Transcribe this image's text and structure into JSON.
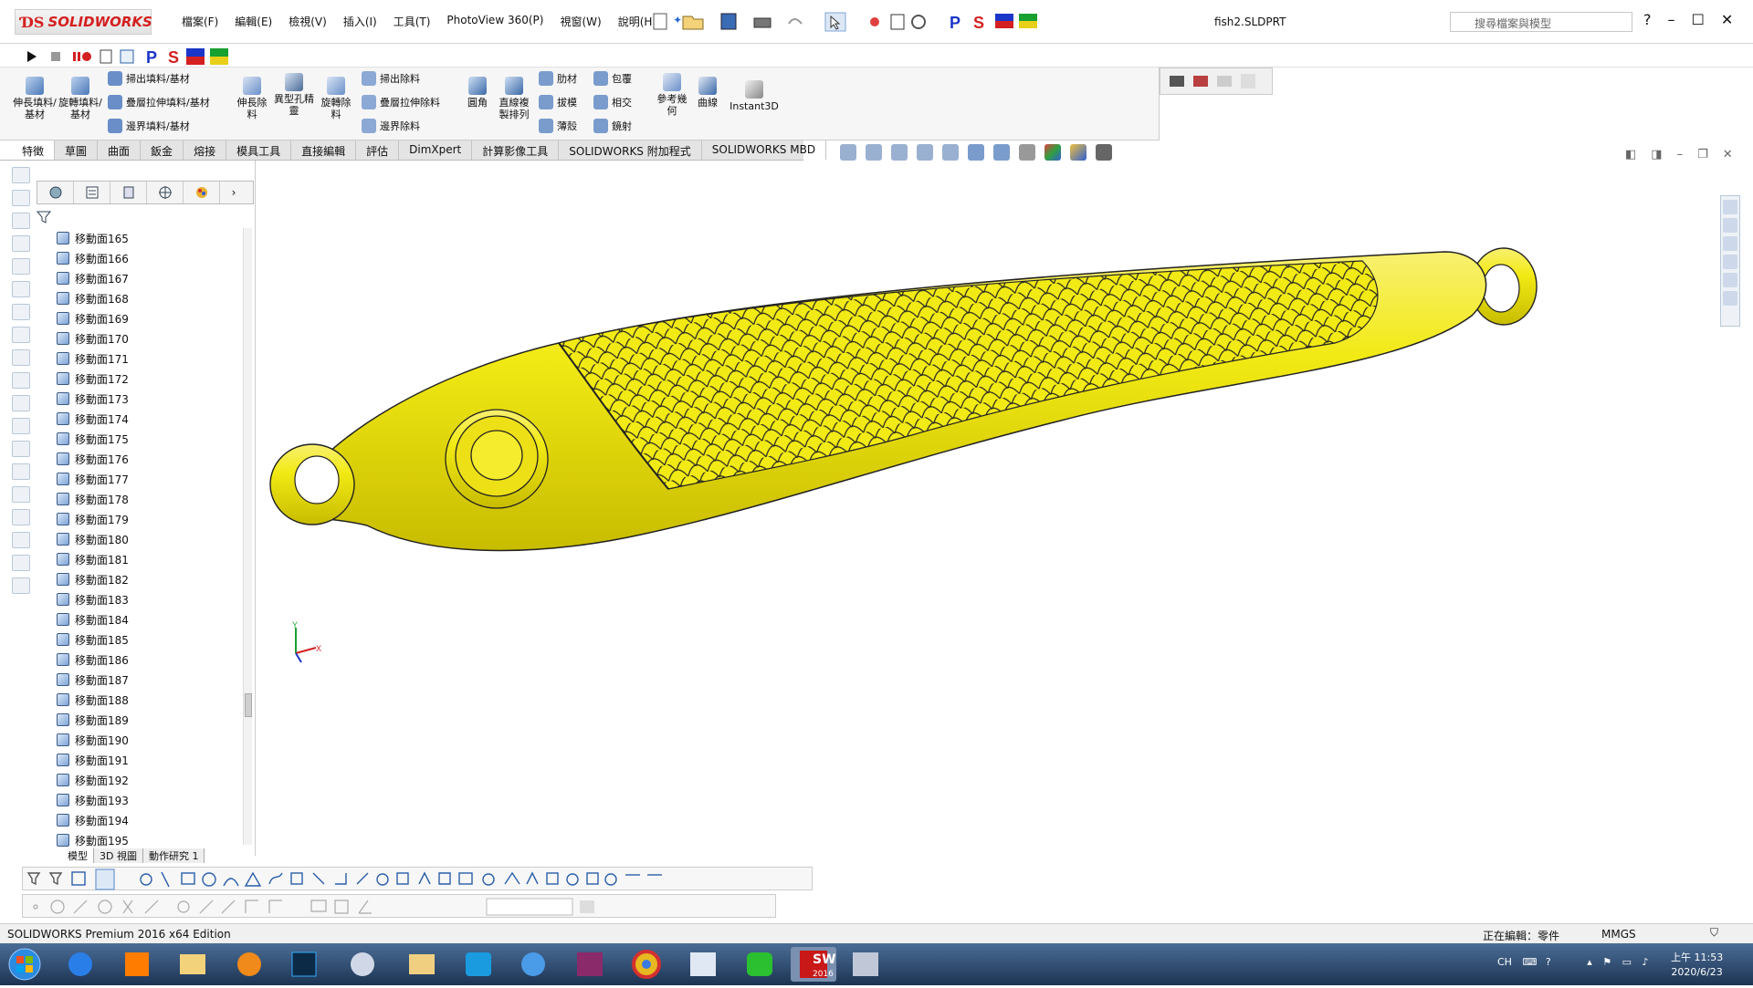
{
  "app": {
    "name": "SOLIDWORKS",
    "document_title": "fish2.SLDPRT"
  },
  "menu": [
    "檔案(F)",
    "編輯(E)",
    "檢視(V)",
    "插入(I)",
    "工具(T)",
    "PhotoView 360(P)",
    "視窗(W)",
    "說明(H)"
  ],
  "search": {
    "placeholder": "搜尋檔案與模型"
  },
  "commands": {
    "big": [
      {
        "label": "伸長填料/基材"
      },
      {
        "label": "旋轉填料/基材"
      },
      {
        "label": "伸長除料"
      },
      {
        "label": "異型孔精靈"
      },
      {
        "label": "旋轉除料"
      },
      {
        "label": "圓角"
      },
      {
        "label": "直線複製排列"
      },
      {
        "label": "參考幾何"
      },
      {
        "label": "曲線"
      },
      {
        "label": "Instant3D"
      }
    ],
    "rows": [
      {
        "label": "掃出填料/基材"
      },
      {
        "label": "疊層拉伸填料/基材"
      },
      {
        "label": "邊界填料/基材"
      },
      {
        "label": "掃出除料"
      },
      {
        "label": "疊層拉伸除料"
      },
      {
        "label": "邊界除料"
      },
      {
        "label": "肋材"
      },
      {
        "label": "拔模"
      },
      {
        "label": "薄殼"
      },
      {
        "label": "包覆"
      },
      {
        "label": "相交"
      },
      {
        "label": "鏡射"
      }
    ]
  },
  "tabs": [
    "特徵",
    "草圖",
    "曲面",
    "鈑金",
    "熔接",
    "模具工具",
    "直接編輯",
    "評估",
    "DimXpert",
    "計算影像工具",
    "SOLIDWORKS 附加程式",
    "SOLIDWORKS MBD"
  ],
  "feature_tree": {
    "items": [
      "移動面165",
      "移動面166",
      "移動面167",
      "移動面168",
      "移動面169",
      "移動面170",
      "移動面171",
      "移動面172",
      "移動面173",
      "移動面174",
      "移動面175",
      "移動面176",
      "移動面177",
      "移動面178",
      "移動面179",
      "移動面180",
      "移動面181",
      "移動面182",
      "移動面183",
      "移動面184",
      "移動面185",
      "移動面186",
      "移動面187",
      "移動面188",
      "移動面189",
      "移動面190",
      "移動面191",
      "移動面192",
      "移動面193",
      "移動面194",
      "移動面195"
    ]
  },
  "bottom_tabs": [
    "模型",
    "3D 視圖",
    "動作研究 1"
  ],
  "axis": {
    "x": "X",
    "y": "Y"
  },
  "status": {
    "edition": "SOLIDWORKS Premium 2016 x64 Edition",
    "editing": "正在編輯：零件",
    "units": "MMGS"
  },
  "taskbar": {
    "lang": "CH",
    "time": "上午 11:53",
    "date": "2020/6/23",
    "sw_label": "SW",
    "sw_year": "2016"
  },
  "colors": {
    "model": "#f2ea14",
    "brand": "#d42020",
    "taskbar": "#2b4568"
  }
}
